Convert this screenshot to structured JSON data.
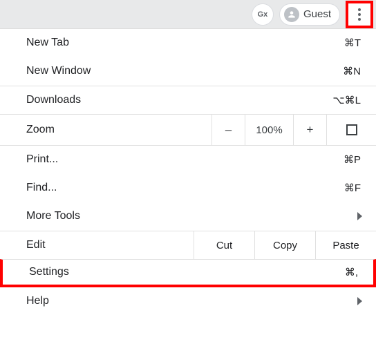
{
  "toolbar": {
    "translate_icon_label": "Gx",
    "guest_label": "Guest"
  },
  "menu": {
    "new_tab": {
      "label": "New Tab",
      "shortcut": "⌘T"
    },
    "new_window": {
      "label": "New Window",
      "shortcut": "⌘N"
    },
    "downloads": {
      "label": "Downloads",
      "shortcut": "⌥⌘L"
    },
    "zoom": {
      "label": "Zoom",
      "minus": "–",
      "value": "100%",
      "plus": "+"
    },
    "print": {
      "label": "Print...",
      "shortcut": "⌘P"
    },
    "find": {
      "label": "Find...",
      "shortcut": "⌘F"
    },
    "more_tools": {
      "label": "More Tools"
    },
    "edit": {
      "label": "Edit",
      "cut": "Cut",
      "copy": "Copy",
      "paste": "Paste"
    },
    "settings": {
      "label": "Settings",
      "shortcut": "⌘,"
    },
    "help": {
      "label": "Help"
    }
  }
}
